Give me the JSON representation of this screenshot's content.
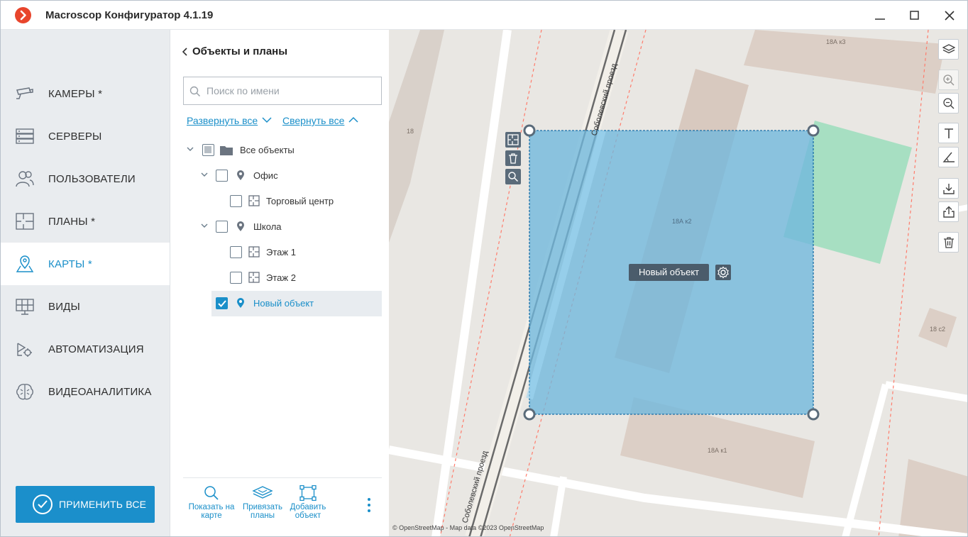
{
  "app": {
    "title": "Macroscop Конфигуратор 4.1.19"
  },
  "nav": {
    "items": [
      {
        "label": "КАМЕРЫ",
        "modified": "*",
        "icon": "camera-icon"
      },
      {
        "label": "СЕРВЕРЫ",
        "modified": "",
        "icon": "server-icon"
      },
      {
        "label": "ПОЛЬЗОВАТЕЛИ",
        "modified": "",
        "icon": "users-icon"
      },
      {
        "label": "ПЛАНЫ",
        "modified": "*",
        "icon": "floor-plan-icon"
      },
      {
        "label": "КАРТЫ",
        "modified": "*",
        "icon": "map-pin-icon"
      },
      {
        "label": "ВИДЫ",
        "modified": "",
        "icon": "layouts-icon"
      },
      {
        "label": "АВТОМАТИЗАЦИЯ",
        "modified": "",
        "icon": "automation-icon"
      },
      {
        "label": "ВИДЕОАНАЛИТИКА",
        "modified": "",
        "icon": "brain-icon"
      }
    ],
    "active": "КАРТЫ",
    "apply_label": "ПРИМЕНИТЬ ВСЕ"
  },
  "panel": {
    "title": "Объекты и планы",
    "search_placeholder": "Поиск по имени",
    "expand_all": "Развернуть все",
    "collapse_all": "Свернуть все",
    "tree": [
      {
        "label": "Все объекты",
        "type": "folder",
        "level": 0,
        "state": "partial"
      },
      {
        "label": "Офис",
        "type": "location",
        "level": 1,
        "state": "unchecked"
      },
      {
        "label": "Торговый центр",
        "type": "plan",
        "level": 2,
        "state": "unchecked"
      },
      {
        "label": "Школа",
        "type": "location",
        "level": 1,
        "state": "unchecked"
      },
      {
        "label": "Этаж 1",
        "type": "plan",
        "level": 2,
        "state": "unchecked"
      },
      {
        "label": "Этаж 2",
        "type": "plan",
        "level": 2,
        "state": "unchecked"
      },
      {
        "label": "Новый объект",
        "type": "location",
        "level": 1,
        "state": "checked",
        "selected": true
      }
    ],
    "footer": {
      "show_on_map": "Показать на карте",
      "link_plans": "Привязать планы",
      "add_object": "Добавить объект"
    }
  },
  "map": {
    "object_label": "Новый объект",
    "street_name": "Соболевский проезд",
    "building_labels": [
      "18А к3",
      "18",
      "18А к2",
      "18 с2",
      "18А к1"
    ],
    "attribution": "© OpenStreetMap - Map data ©2023 OpenStreetMap",
    "tools": [
      "layers-icon",
      "zoom-in-icon",
      "zoom-out-icon",
      "text-icon",
      "ruler-icon",
      "download-icon",
      "share-icon",
      "trash-icon"
    ]
  },
  "colors": {
    "accent": "#1a8fc9",
    "selection_fill": "#6fb7dc",
    "map_bg": "#e9e7e3"
  }
}
